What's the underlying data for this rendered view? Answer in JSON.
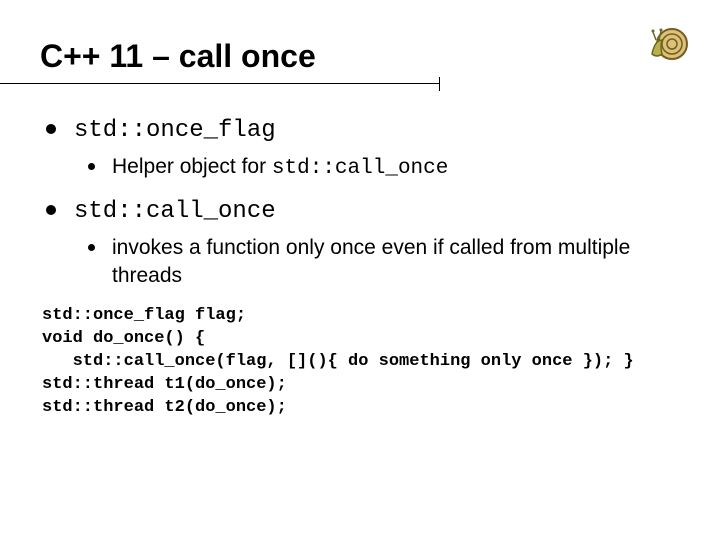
{
  "title": "C++ 11 – call once",
  "bullets": [
    {
      "label": "std::once_flag",
      "sub": [
        {
          "prefix": "Helper object for ",
          "code": "std::call_once"
        }
      ]
    },
    {
      "label": "std::call_once",
      "sub": [
        {
          "text": "invokes a function only once even if called from multiple threads"
        }
      ]
    }
  ],
  "code": "std::once_flag flag;\nvoid do_once() {\n   std::call_once(flag, [](){ do something only once }); }\nstd::thread t1(do_once);\nstd::thread t2(do_once);",
  "icon_name": "snail-icon"
}
